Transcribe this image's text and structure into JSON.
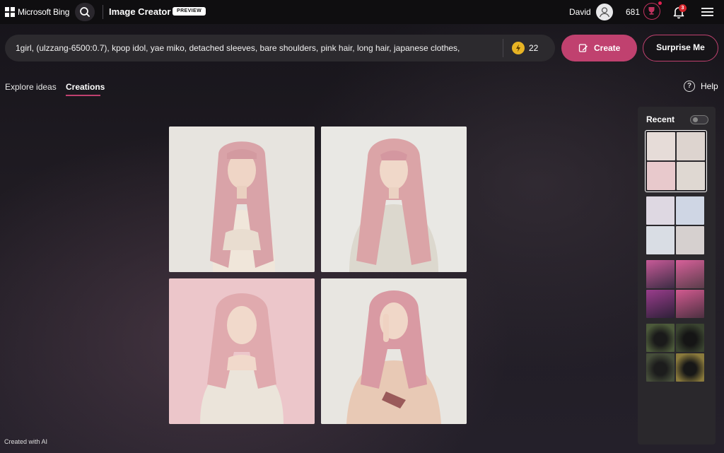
{
  "header": {
    "brand": "Microsoft Bing",
    "app_title": "Image Creator",
    "preview_badge": "PREVIEW",
    "user_name": "David",
    "points": "681",
    "notifications_count": "3",
    "icons": [
      "microsoft-logo-icon",
      "search-icon",
      "avatar-icon",
      "trophy-icon",
      "bell-icon",
      "menu-icon"
    ]
  },
  "prompt": {
    "text": "1girl, (ulzzang-6500:0.7), kpop idol, yae miko, detached sleeves, bare shoulders, pink hair, long hair, japanese clothes,",
    "boosts": "22",
    "create_label": "Create",
    "surprise_label": "Surprise Me"
  },
  "tabs": {
    "explore": "Explore ideas",
    "creations": "Creations",
    "active": "Creations"
  },
  "help_label": "Help",
  "recent": {
    "title": "Recent",
    "toggle_on": false,
    "sets": [
      {
        "theme": "pink-hair-portraits",
        "selected": true,
        "colors": [
          "#e6dcd8",
          "#ddd4cf",
          "#e8c9cc",
          "#dfd8d2"
        ]
      },
      {
        "theme": "pink-hair-portraits",
        "selected": false,
        "colors": [
          "#ded8e2",
          "#cfd6e4",
          "#d9dde4",
          "#d6d0cf"
        ]
      },
      {
        "theme": "pink-hair-warriors",
        "selected": false,
        "colors": [
          "#4b3b4c",
          "#5a3d4a",
          "#3c2c44",
          "#4c3040"
        ]
      },
      {
        "theme": "black-cats",
        "selected": false,
        "colors": [
          "#4c5a3a",
          "#3a4430",
          "#464e3a",
          "#5a5a3c"
        ]
      }
    ]
  },
  "images": [
    {
      "id": "creation-1",
      "bg": "#e7e4df",
      "hair": "#d9a3a8"
    },
    {
      "id": "creation-2",
      "bg": "#e9e8e4",
      "hair": "#dba4a7"
    },
    {
      "id": "creation-3",
      "bg": "#ecc6ca",
      "hair": "#e0aaae"
    },
    {
      "id": "creation-4",
      "bg": "#e8e6e1",
      "hair": "#d99aa3"
    }
  ],
  "footer": "Created with AI",
  "colors": {
    "accent": "#c0416f",
    "header_bg": "#0f0e10",
    "prompt_bg": "#2c2a2e",
    "panel_bg": "#2a282c"
  }
}
